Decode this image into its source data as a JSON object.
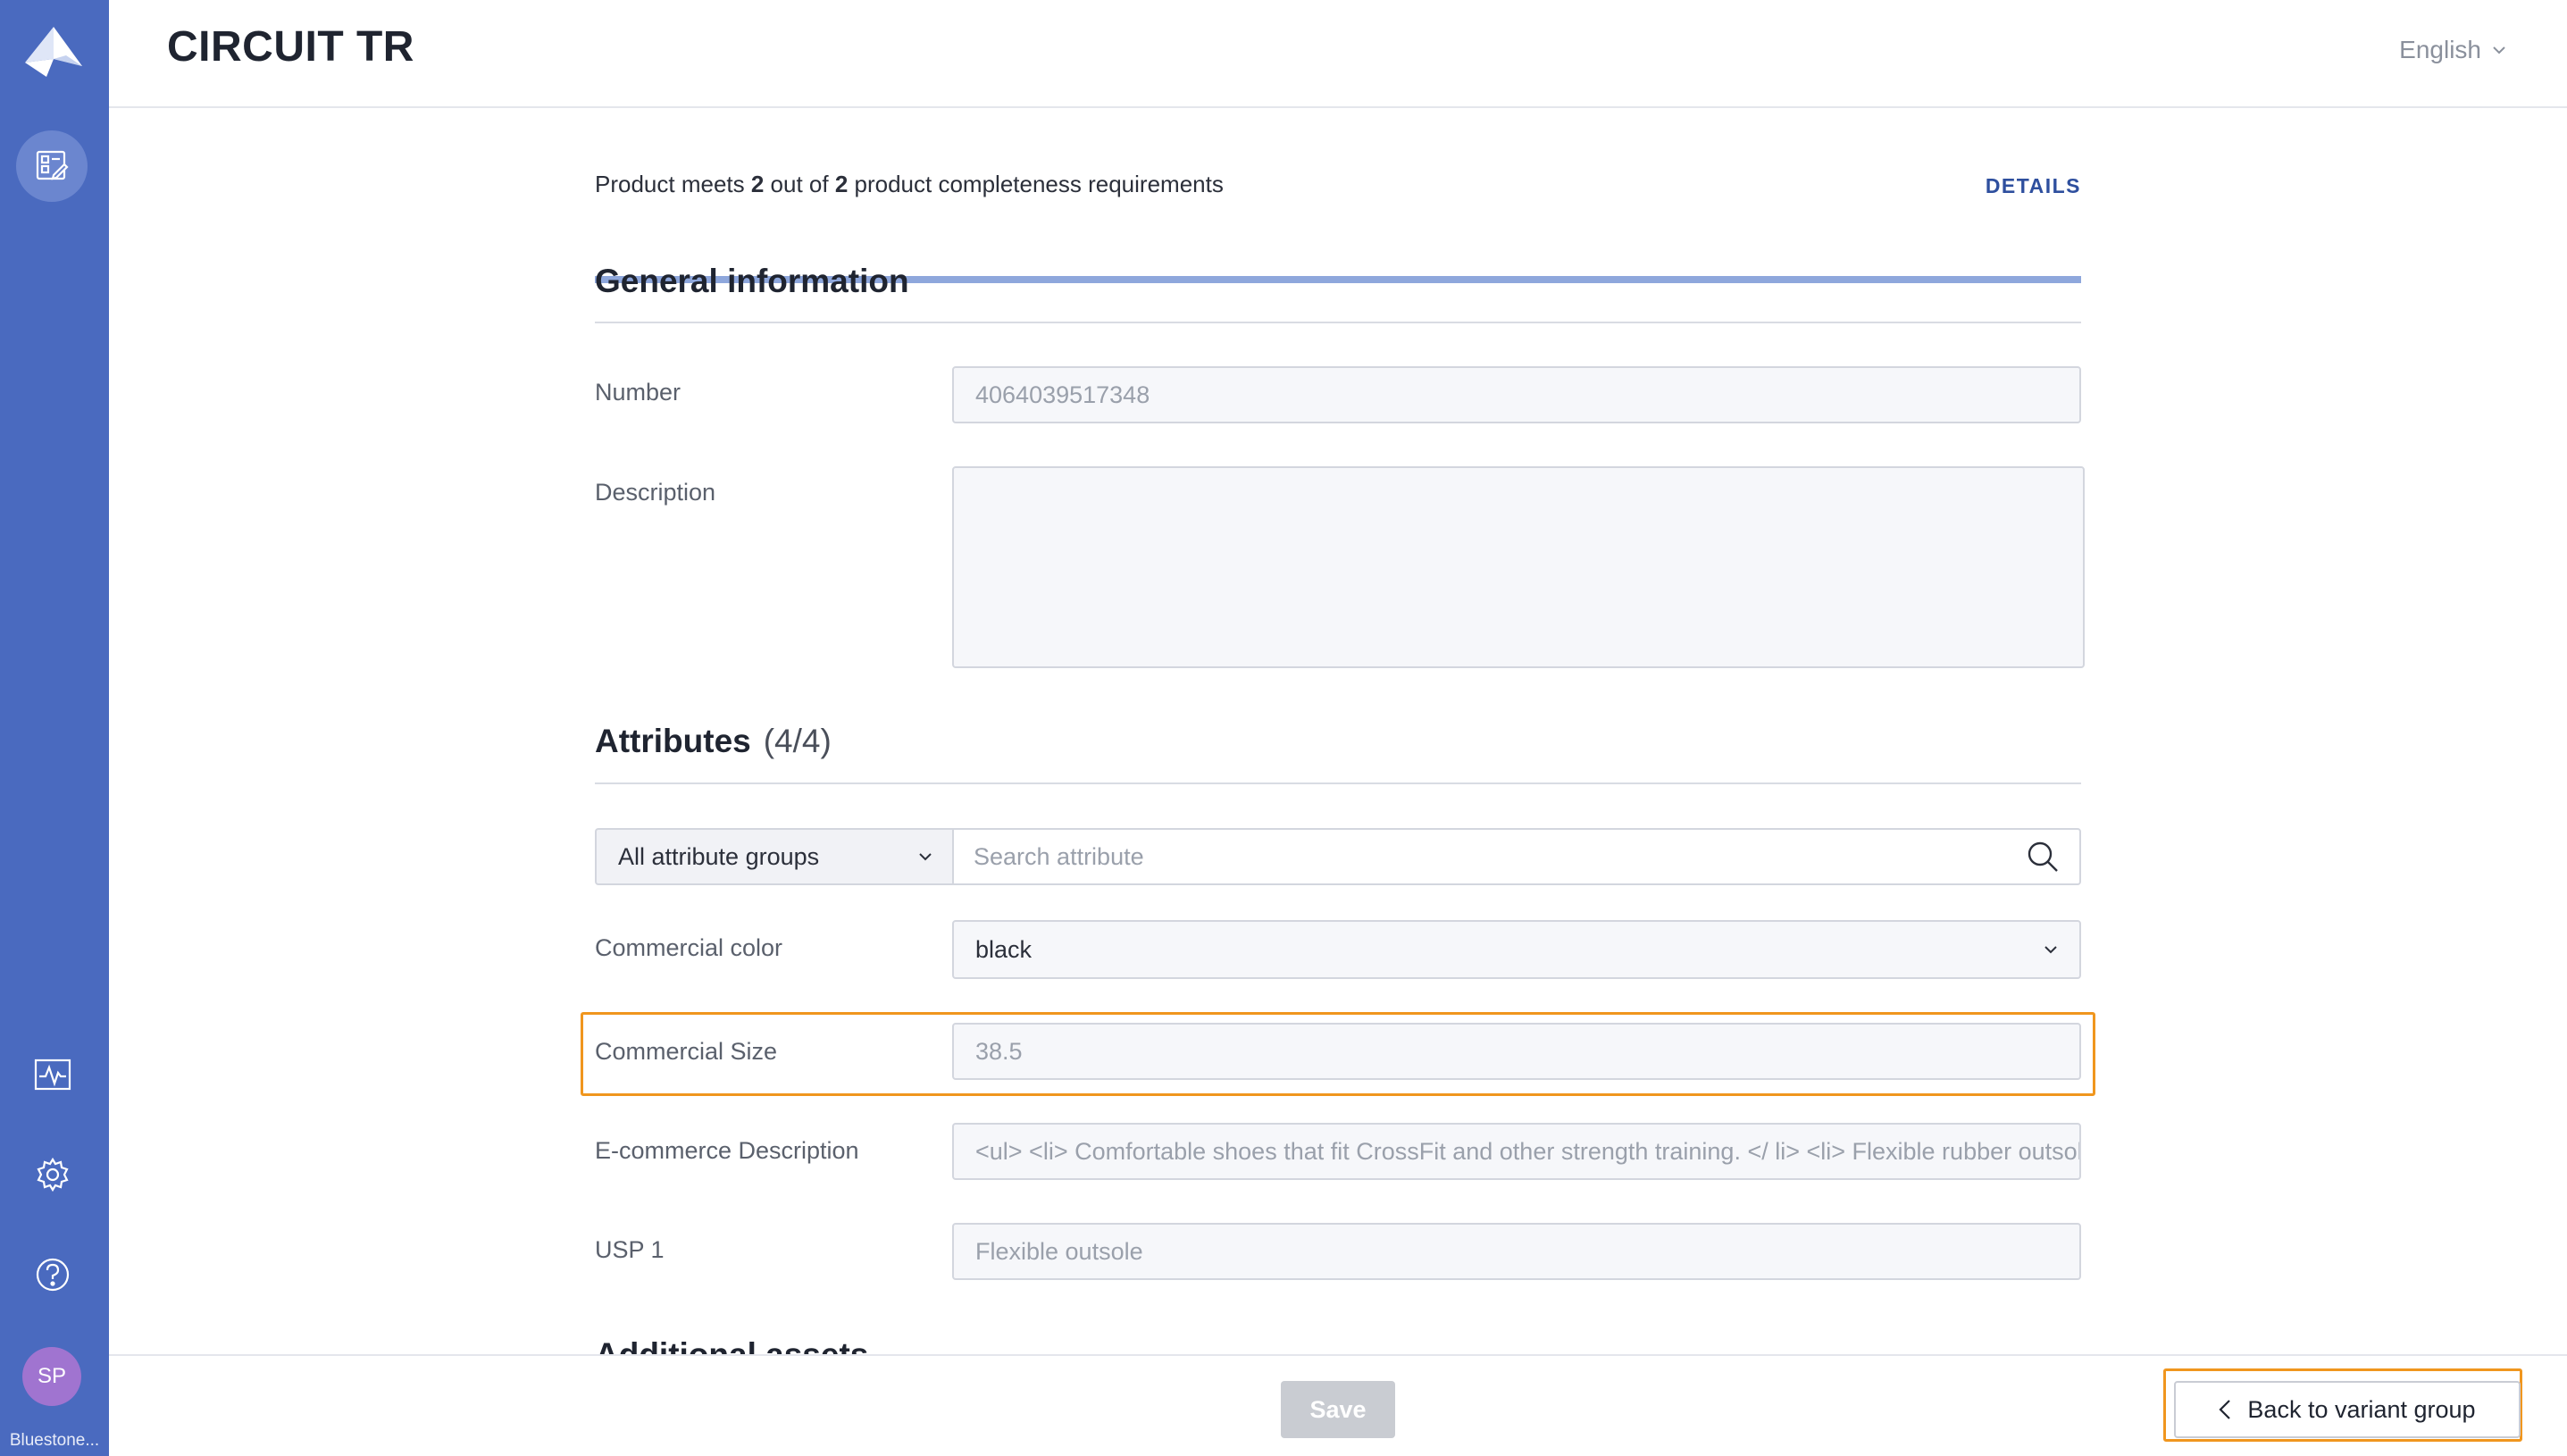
{
  "app": {
    "org_name": "Bluestone..."
  },
  "header": {
    "title": "CIRCUIT TR",
    "language": "English"
  },
  "completeness": {
    "prefix": "Product meets ",
    "met": "2",
    "middle": " out of ",
    "total": "2",
    "suffix": " product completeness requirements",
    "details_label": "DETAILS"
  },
  "general": {
    "title": "General information",
    "number_label": "Number",
    "number_value": "4064039517348",
    "description_label": "Description",
    "description_value": ""
  },
  "attributes": {
    "title": "Attributes",
    "count": "(4/4)",
    "group_filter": "All attribute groups",
    "search_placeholder": "Search attribute",
    "rows": [
      {
        "label": "Commercial color",
        "value": "black"
      },
      {
        "label": "Commercial Size",
        "value": "38.5"
      },
      {
        "label": "E-commerce Description",
        "value": "<ul> <li> Comfortable shoes that fit CrossFit and other strength training. </ li> <li> Flexible rubber outsole"
      },
      {
        "label": "USP 1",
        "value": "Flexible outsole"
      }
    ]
  },
  "next_section": {
    "title": "Additional assets"
  },
  "footer": {
    "save_label": "Save",
    "back_label": "Back to variant group"
  },
  "sidebar": {
    "avatar_initials": "SP",
    "icons": [
      "logo-icon",
      "product-edit-icon",
      "activity-icon",
      "gear-icon",
      "help-icon"
    ]
  },
  "colors": {
    "sidebar": "#4a6abf",
    "highlight": "#f0961e",
    "link": "#2e4f9e",
    "avatar": "#a074d0"
  }
}
